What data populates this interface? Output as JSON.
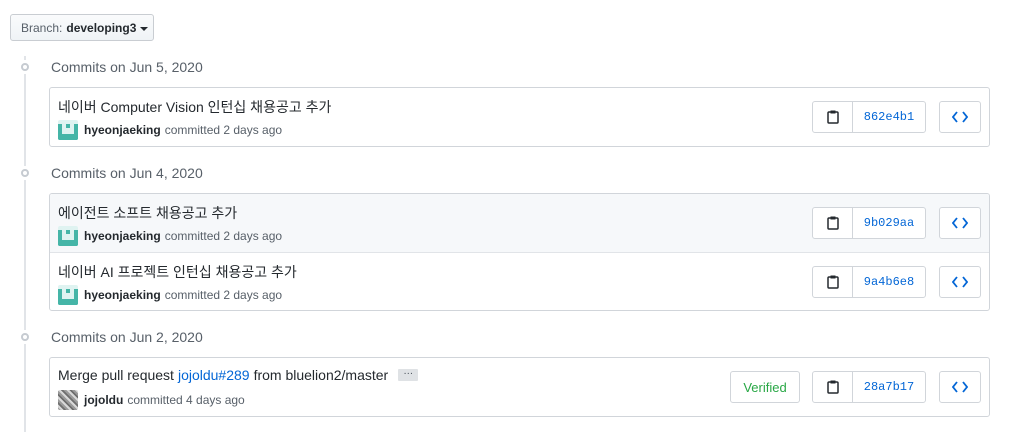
{
  "branch": {
    "label": "Branch:",
    "name": "developing3"
  },
  "groups": [
    {
      "date": "Commits on Jun 5, 2020",
      "commits": [
        {
          "message": "네이버 Computer Vision 인턴십 채용공고 추가",
          "author": "hyeonjaeking",
          "when": "committed 2 days ago",
          "sha": "862e4b1"
        }
      ]
    },
    {
      "date": "Commits on Jun 4, 2020",
      "commits": [
        {
          "message": "에이전트 소프트 채용공고 추가",
          "author": "hyeonjaeking",
          "when": "committed 2 days ago",
          "sha": "9b029aa"
        },
        {
          "message": "네이버 AI 프로젝트 인턴십 채용공고 추가",
          "author": "hyeonjaeking",
          "when": "committed 2 days ago",
          "sha": "9a4b6e8"
        }
      ]
    },
    {
      "date": "Commits on Jun 2, 2020",
      "commits": [
        {
          "message_prefix": "Merge pull request",
          "message_link": "jojoldu#289",
          "message_suffix": "from bluelion2/master",
          "ellipsis": "…",
          "author": "jojoldu",
          "when": "committed 4 days ago",
          "badge": "Verified",
          "sha": "28a7b17"
        }
      ]
    }
  ],
  "icons": {
    "copy": "clipboard-icon",
    "browse": "code-icon",
    "timeline": "commit-dot-icon"
  },
  "colors": {
    "link": "#0366d6",
    "verified": "#28a745"
  }
}
